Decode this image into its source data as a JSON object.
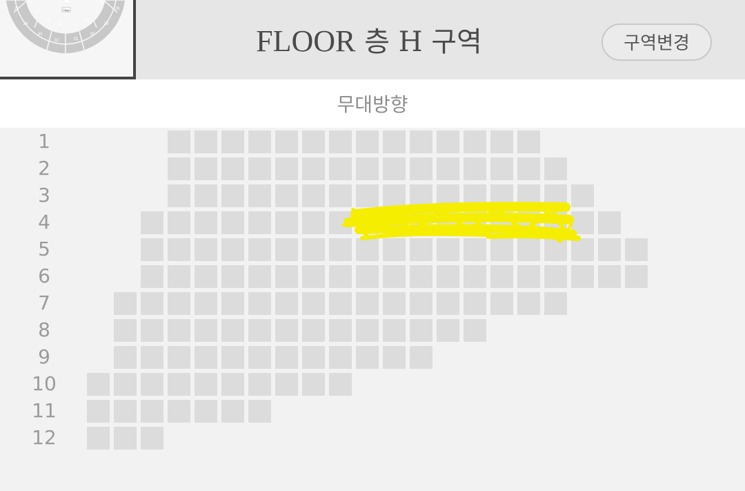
{
  "header": {
    "title_floor": "FLOOR",
    "title_rest": "층 H 구역",
    "change_button_label": "구역변경"
  },
  "minimap": {
    "section_numbers": [
      "17",
      "25",
      "16",
      "34",
      "15",
      "33",
      "14",
      "32",
      "13",
      "31",
      "12",
      "30",
      "11",
      "29",
      "10",
      "28"
    ],
    "stage_label": "Stage"
  },
  "stage": {
    "label": "무대방향"
  },
  "seatmap": {
    "rows": [
      {
        "label": "1",
        "start": 3,
        "count": 14
      },
      {
        "label": "2",
        "start": 3,
        "count": 15
      },
      {
        "label": "3",
        "start": 3,
        "count": 16
      },
      {
        "label": "4",
        "start": 2,
        "count": 18
      },
      {
        "label": "5",
        "start": 2,
        "count": 19
      },
      {
        "label": "6",
        "start": 2,
        "count": 19
      },
      {
        "label": "7",
        "start": 1,
        "count": 17
      },
      {
        "label": "8",
        "start": 1,
        "count": 14
      },
      {
        "label": "9",
        "start": 1,
        "count": 12
      },
      {
        "label": "10",
        "start": 0,
        "count": 10
      },
      {
        "label": "11",
        "start": 0,
        "count": 7
      },
      {
        "label": "12",
        "start": 0,
        "count": 3
      }
    ],
    "seat_color": "#dcdcdc",
    "highlight_color": "#f5ee00"
  }
}
